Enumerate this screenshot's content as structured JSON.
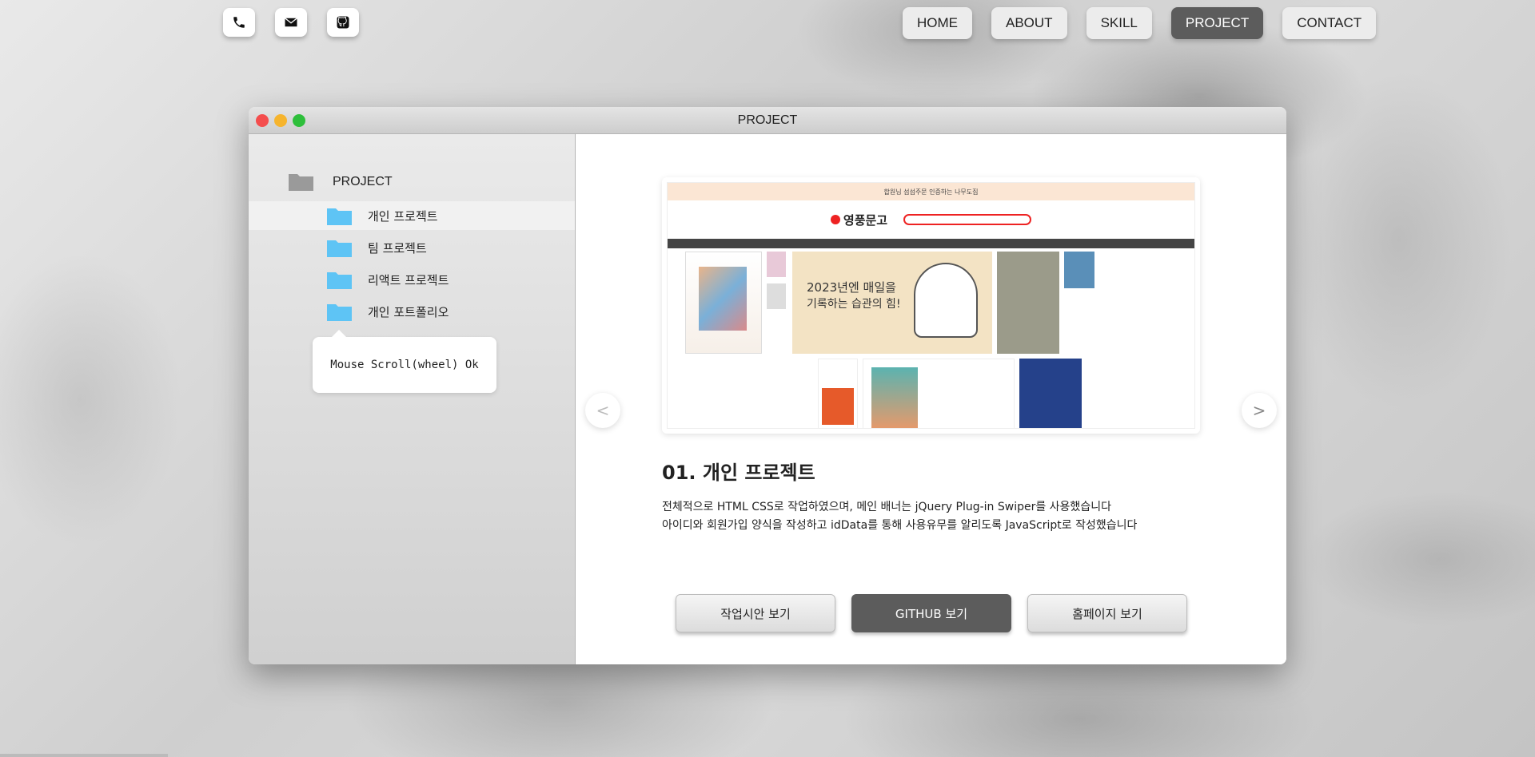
{
  "contact": {
    "icons": [
      "phone-icon",
      "mail-icon",
      "github-icon"
    ]
  },
  "nav": {
    "items": [
      "HOME",
      "ABOUT",
      "SKILL",
      "PROJECT",
      "CONTACT"
    ],
    "active": "PROJECT"
  },
  "window": {
    "title": "PROJECT"
  },
  "sidebar": {
    "root": "PROJECT",
    "items": [
      {
        "label": "개인 프로젝트",
        "selected": true
      },
      {
        "label": "팀 프로젝트",
        "selected": false
      },
      {
        "label": "리액트 프로젝트",
        "selected": false
      },
      {
        "label": "개인 포트폴리오",
        "selected": false
      }
    ],
    "tooltip": "Mouse Scroll(wheel) Ok"
  },
  "slider": {
    "prev": "<",
    "next": ">",
    "preview": {
      "top_banner": "합원님 섬섬주문 인증하는 나무도집",
      "logo": "영풍문고",
      "banner_line1": "2023년엔 매일을",
      "banner_line2": "기록하는 습관의 힘!"
    }
  },
  "project": {
    "title": "01. 개인 프로젝트",
    "desc_line1": "전체적으로 HTML CSS로 작업하였으며, 메인 배너는 jQuery Plug-in Swiper를 사용했습니다",
    "desc_line2": "아이디와 회원가입 양식을 작성하고 idData를 통해 사용유무를 알리도록 JavaScript로 작성했습니다",
    "buttons": {
      "draft": "작업시안 보기",
      "github": "GITHUB 보기",
      "homepage": "홈페이지 보기"
    }
  },
  "colors": {
    "active_nav": "#5c5c5c",
    "folder_blue": "#5ec4f5",
    "folder_gray": "#9a9a9a"
  }
}
